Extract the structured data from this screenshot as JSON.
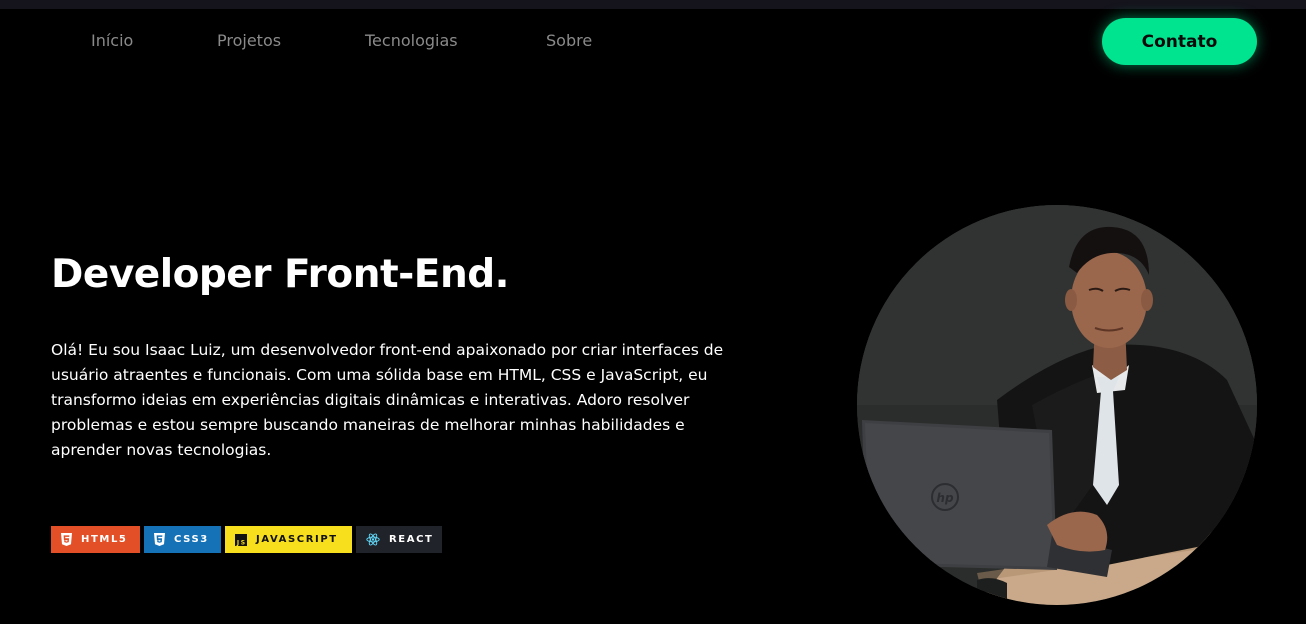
{
  "nav": {
    "items": [
      "Início",
      "Projetos",
      "Tecnologias",
      "Sobre"
    ],
    "contact_label": "Contato"
  },
  "hero": {
    "title": "Developer Front-End.",
    "description": "Olá! Eu sou Isaac Luiz, um desenvolvedor front-end apaixonado por criar interfaces de usuário atraentes e funcionais. Com uma sólida base em HTML, CSS e JavaScript, eu transformo ideias em experiências digitais dinâmicas e interativas. Adoro resolver problemas e estou sempre buscando maneiras de melhorar minhas habilidades e aprender novas tecnologias.",
    "badges": [
      {
        "label": "HTML5",
        "icon": "html5-icon",
        "color": "#e34f26"
      },
      {
        "label": "CSS3",
        "icon": "css3-icon",
        "color": "#1572b6"
      },
      {
        "label": "JAVASCRIPT",
        "icon": "javascript-icon",
        "color": "#f7df1e"
      },
      {
        "label": "REACT",
        "icon": "react-icon",
        "color": "#20232a"
      }
    ]
  },
  "colors": {
    "accent": "#00e38f",
    "background": "#000000",
    "nav_text": "#8a8a8a"
  },
  "photo": {
    "laptop_logo": "hp"
  }
}
